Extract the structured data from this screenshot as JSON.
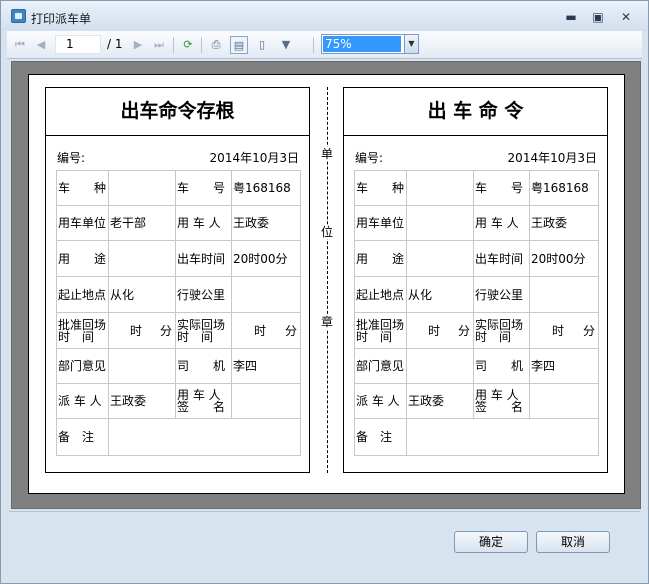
{
  "window": {
    "title": "打印派车单"
  },
  "toolbar": {
    "page_current": "1",
    "page_total": "/ 1",
    "zoom": "75%"
  },
  "stub_form": {
    "title": "出车命令存根",
    "number_label": "编号:",
    "date": "2014年10月3日",
    "rows": {
      "r1": [
        "车　　种",
        "",
        "车　　号",
        "粤168168"
      ],
      "r2": [
        "用车单位",
        "老干部",
        "用 车 人",
        "王政委"
      ],
      "r3": [
        "用　　途",
        "",
        "出车时间",
        "20时00分"
      ],
      "r4": [
        "起止地点",
        "从化",
        "行驶公里",
        ""
      ],
      "r5": {
        "a1": "批准回场",
        "a2": "时　间",
        "hour": "时",
        "min": "分",
        "b1": "实际回场",
        "b2": "时　间",
        "hour2": "时",
        "min2": "分"
      },
      "r6": [
        "部门意见",
        "",
        "司　　机",
        "李四"
      ],
      "r7": {
        "label": "派 车 人",
        "value": "王政委",
        "s1": "用 车 人",
        "s2": "签　　名",
        "sign": ""
      },
      "r8": [
        "备　注",
        ""
      ]
    }
  },
  "order_form": {
    "title": "出 车 命 令",
    "number_label": "编号:",
    "date": "2014年10月3日",
    "rows": {
      "r1": [
        "车　　种",
        "",
        "车　　号",
        "粤168168"
      ],
      "r2": [
        "用车单位",
        "",
        "用 车 人",
        "王政委"
      ],
      "r3": [
        "用　　途",
        "",
        "出车时间",
        "20时00分"
      ],
      "r4": [
        "起止地点",
        "从化",
        "行驶公里",
        ""
      ],
      "r5": {
        "a1": "批准回场",
        "a2": "时　间",
        "hour": "时",
        "min": "分",
        "b1": "实际回场",
        "b2": "时　间",
        "hour2": "时",
        "min2": "分"
      },
      "r6": [
        "部门意见",
        "",
        "司　　机",
        "李四"
      ],
      "r7": {
        "label": "派 车 人",
        "value": "王政委",
        "s1": "用 车 人",
        "s2": "签　　名",
        "sign": ""
      },
      "r8": [
        "备　注",
        ""
      ]
    }
  },
  "divider_labels": [
    "单",
    "位",
    "章"
  ],
  "buttons": {
    "ok": "确定",
    "cancel": "取消"
  }
}
